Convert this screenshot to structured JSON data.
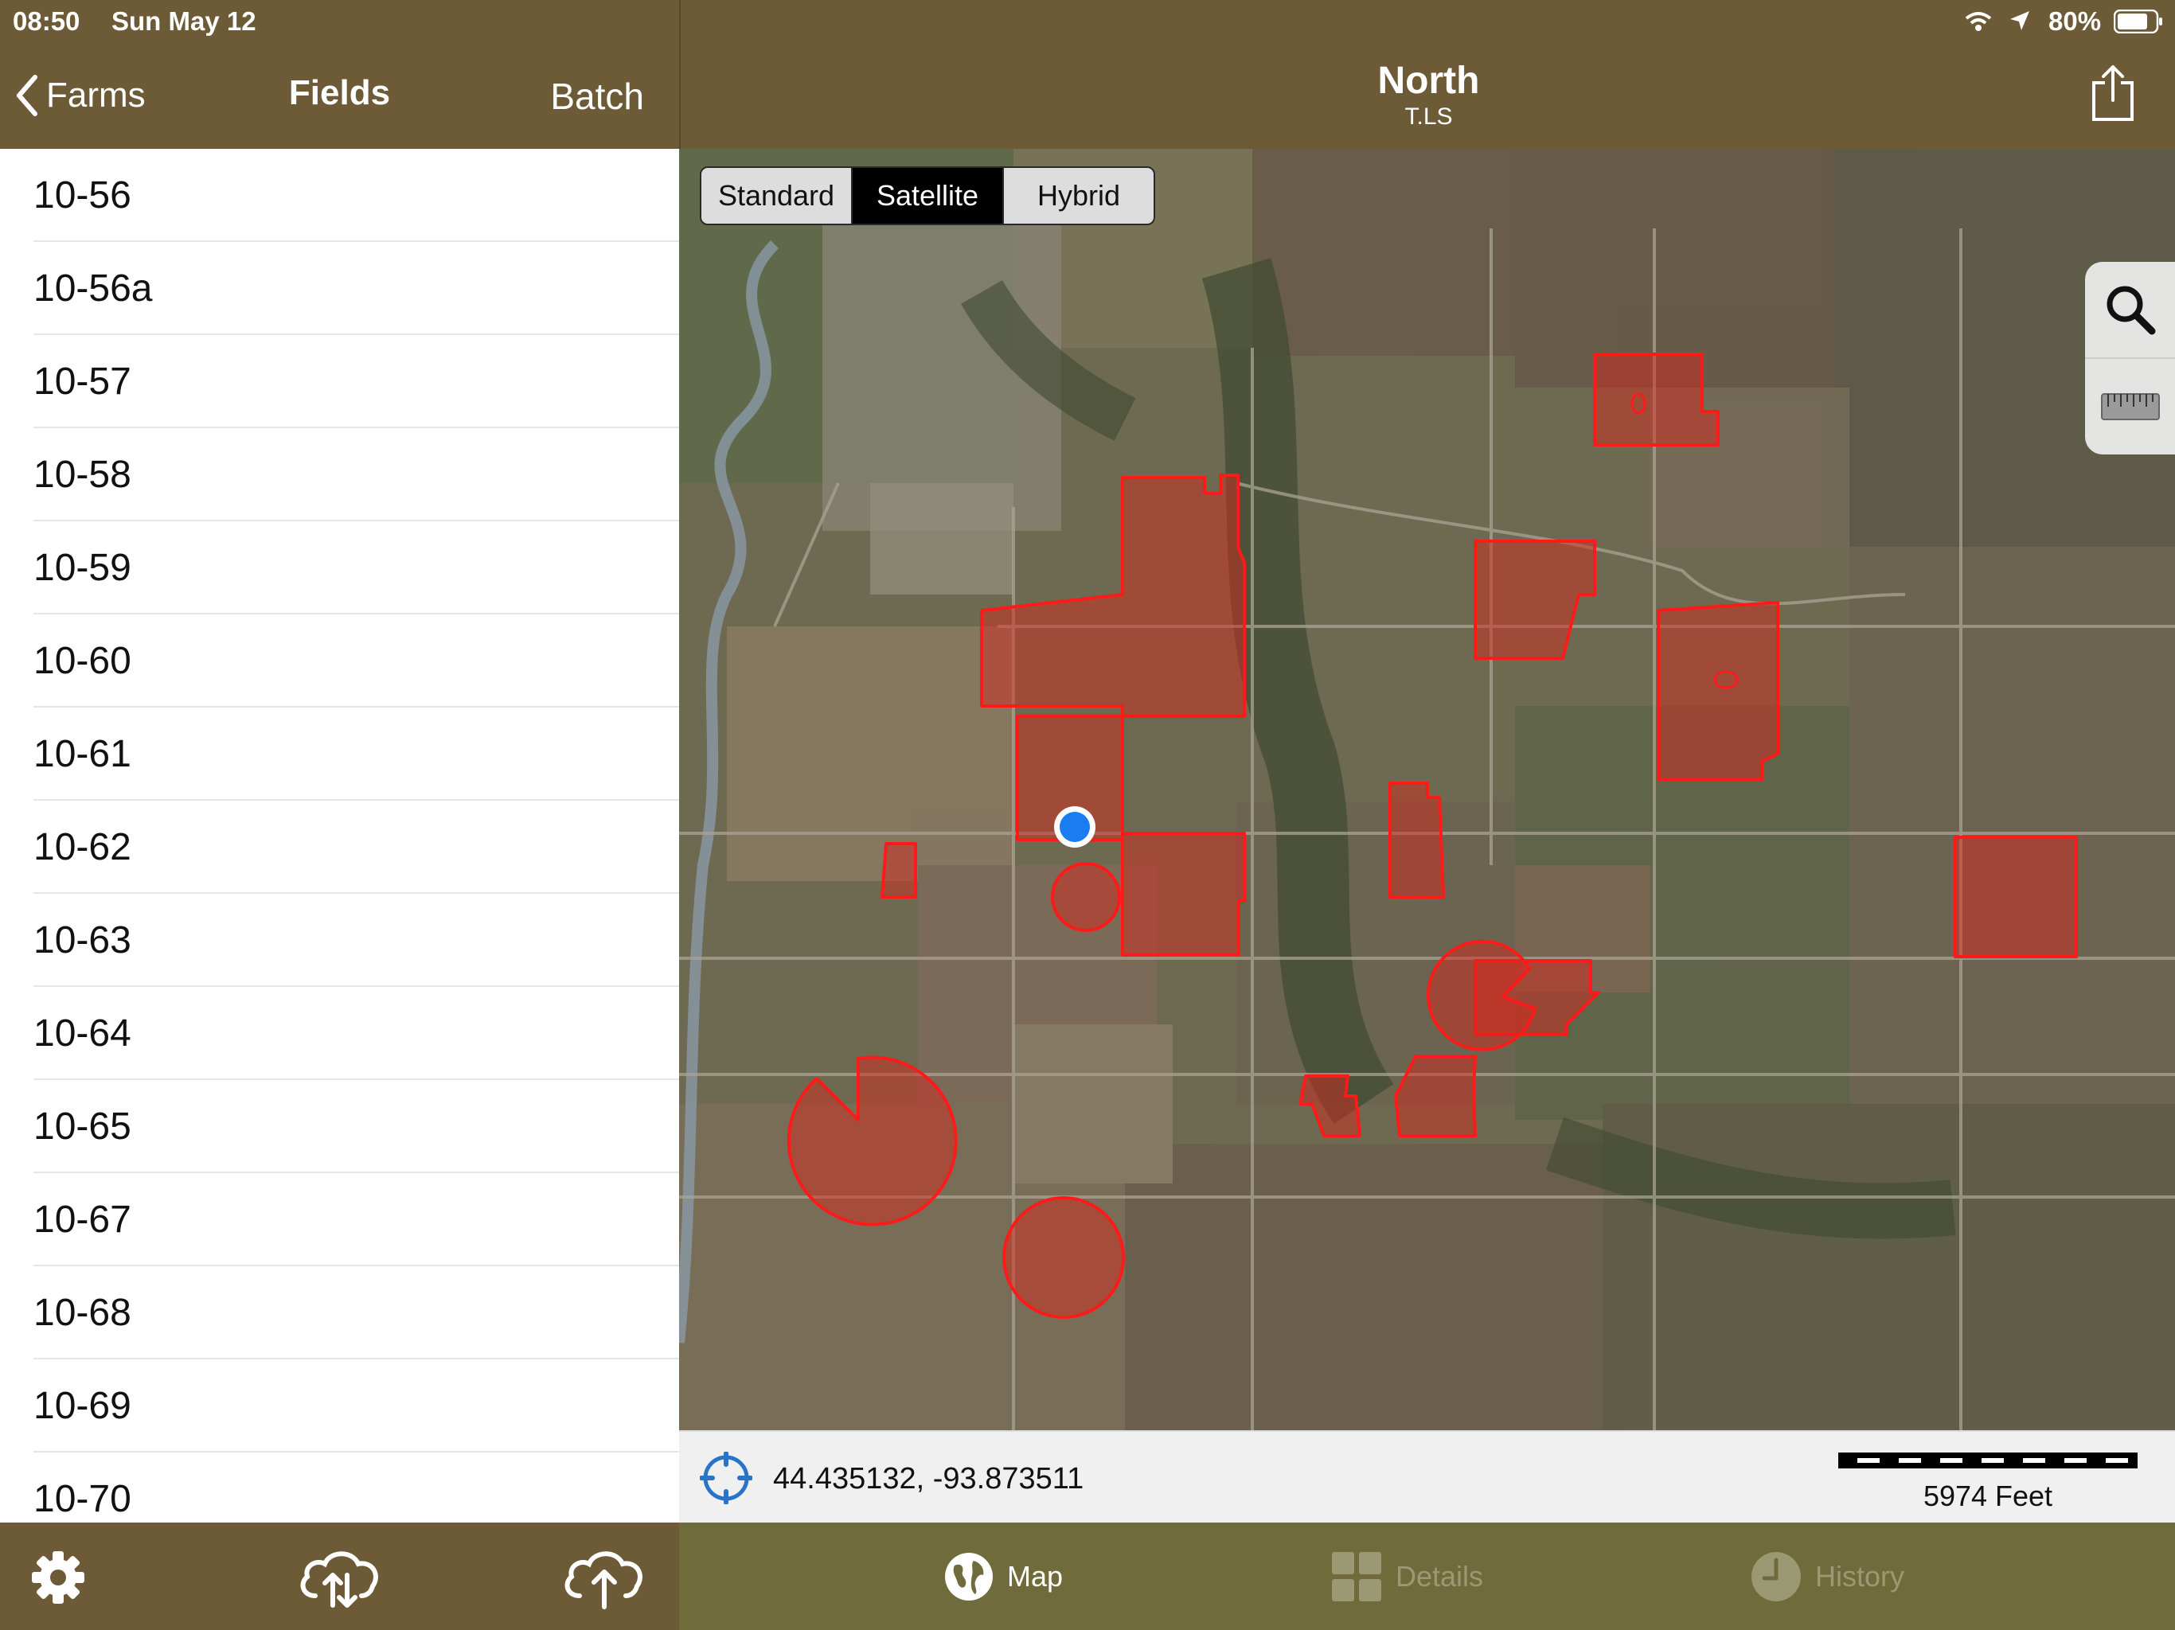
{
  "status": {
    "time": "08:50",
    "date": "Sun May 12",
    "battery": "80%"
  },
  "sidebar": {
    "back_label": "Farms",
    "title": "Fields",
    "batch_label": "Batch",
    "fields": [
      "10-56",
      "10-56a",
      "10-57",
      "10-58",
      "10-59",
      "10-60",
      "10-61",
      "10-62",
      "10-63",
      "10-64",
      "10-65",
      "10-67",
      "10-68",
      "10-69",
      "10-70"
    ]
  },
  "header": {
    "title": "North",
    "subtitle": "T.LS"
  },
  "map": {
    "modes": [
      "Standard",
      "Satellite",
      "Hybrid"
    ],
    "selected_mode": "Satellite"
  },
  "coords": {
    "value": "44.435132, -93.873511",
    "scale_label": "5974 Feet"
  },
  "tabs": {
    "map": "Map",
    "details": "Details",
    "history": "History"
  },
  "colors": {
    "header_brown": "#6d5a36",
    "tabbar_olive": "#6f6b3b",
    "field_red": "#e0201a",
    "location_blue": "#1a7cf0"
  },
  "icons": {
    "settings": "gear-icon",
    "sync": "cloud-sync-icon",
    "upload": "cloud-upload-icon",
    "share": "share-icon",
    "search": "search-icon",
    "ruler": "ruler-icon"
  }
}
